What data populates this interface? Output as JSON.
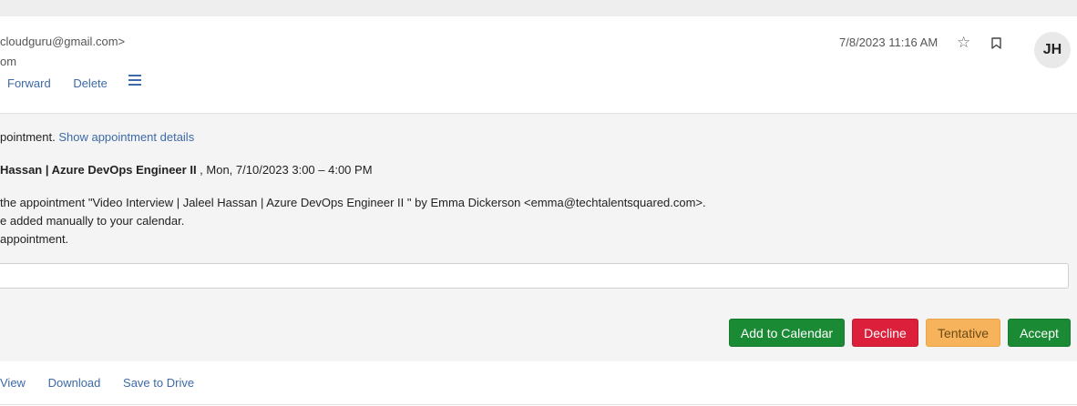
{
  "header": {
    "from_text": "cloudguru@gmail.com>",
    "to_text": "om",
    "date": "7/8/2023 11:16 AM",
    "avatar_initials": "JH",
    "actions": {
      "forward": "Forward",
      "delete": "Delete"
    },
    "icons": [
      "star-icon",
      "bookmark-icon",
      "menu-icon"
    ]
  },
  "invite": {
    "notice_text": "pointment.",
    "show_details_link": "Show appointment details",
    "title_bold": "Hassan | Azure DevOps Engineer II",
    "title_rest": " , Mon, 7/10/2023 3:00 – 4:00 PM",
    "line1": "the appointment \"Video Interview | Jaleel Hassan | Azure DevOps Engineer II \" by Emma Dickerson <emma@techtalentsquared.com>.",
    "line2": "e added manually to your calendar.",
    "line3": "appointment.",
    "comment_value": "",
    "buttons": {
      "add_to_calendar": "Add to Calendar",
      "decline": "Decline",
      "tentative": "Tentative",
      "accept": "Accept"
    },
    "colors": {
      "accept": "#1a8a35",
      "decline": "#dc1f3a",
      "tentative": "#f7b35c",
      "link": "#3d6aa8"
    }
  },
  "attachment": {
    "view": "View",
    "download": "Download",
    "save_to_drive": "Save to Drive"
  }
}
